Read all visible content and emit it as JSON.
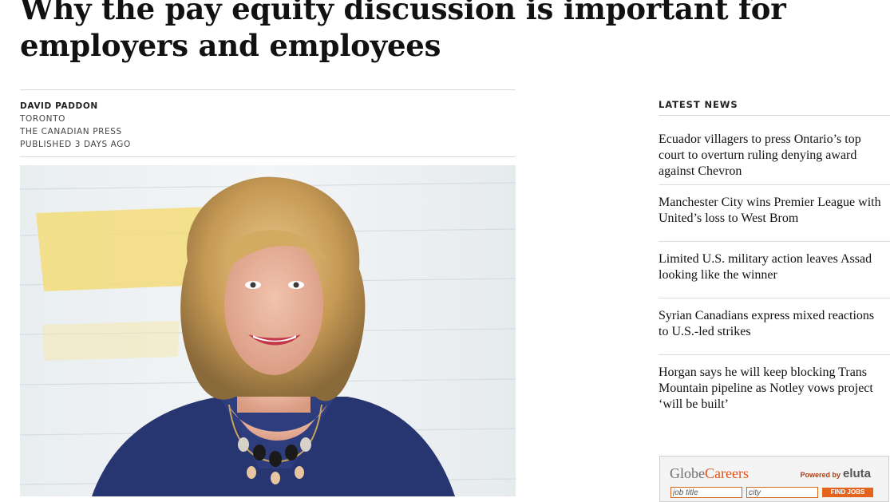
{
  "article": {
    "headline": "Why the pay equity discussion is important for employers and employees",
    "author": "DAVID PADDON",
    "location": "TORONTO",
    "source": "THE CANADIAN PRESS",
    "published": "PUBLISHED 3 DAYS AGO"
  },
  "sidebar": {
    "title": "LATEST NEWS",
    "items": [
      {
        "text": "Ecuador villagers to press Ontario’s top\ncourt to overturn ruling denying award\nagainst Chevron"
      },
      {
        "text": "Manchester City wins Premier League with\nUnited’s loss to West Brom"
      },
      {
        "text": "Limited U.S. military action leaves Assad\nlooking like the winner"
      },
      {
        "text": "Syrian Canadians express mixed reactions\nto U.S.-led strikes"
      },
      {
        "text": "Horgan says he will keep blocking Trans\nMountain pipeline as Notley vows project\n‘will be built’"
      }
    ]
  },
  "ad": {
    "brand_a": "Globe",
    "brand_b": "Careers",
    "powered_by": "Powered by",
    "partner": "eluta",
    "job_placeholder": "job title",
    "city_placeholder": "city",
    "button": "FIND JOBS"
  },
  "colors": {
    "accent": "#e0521a",
    "button": "#e4641e"
  }
}
